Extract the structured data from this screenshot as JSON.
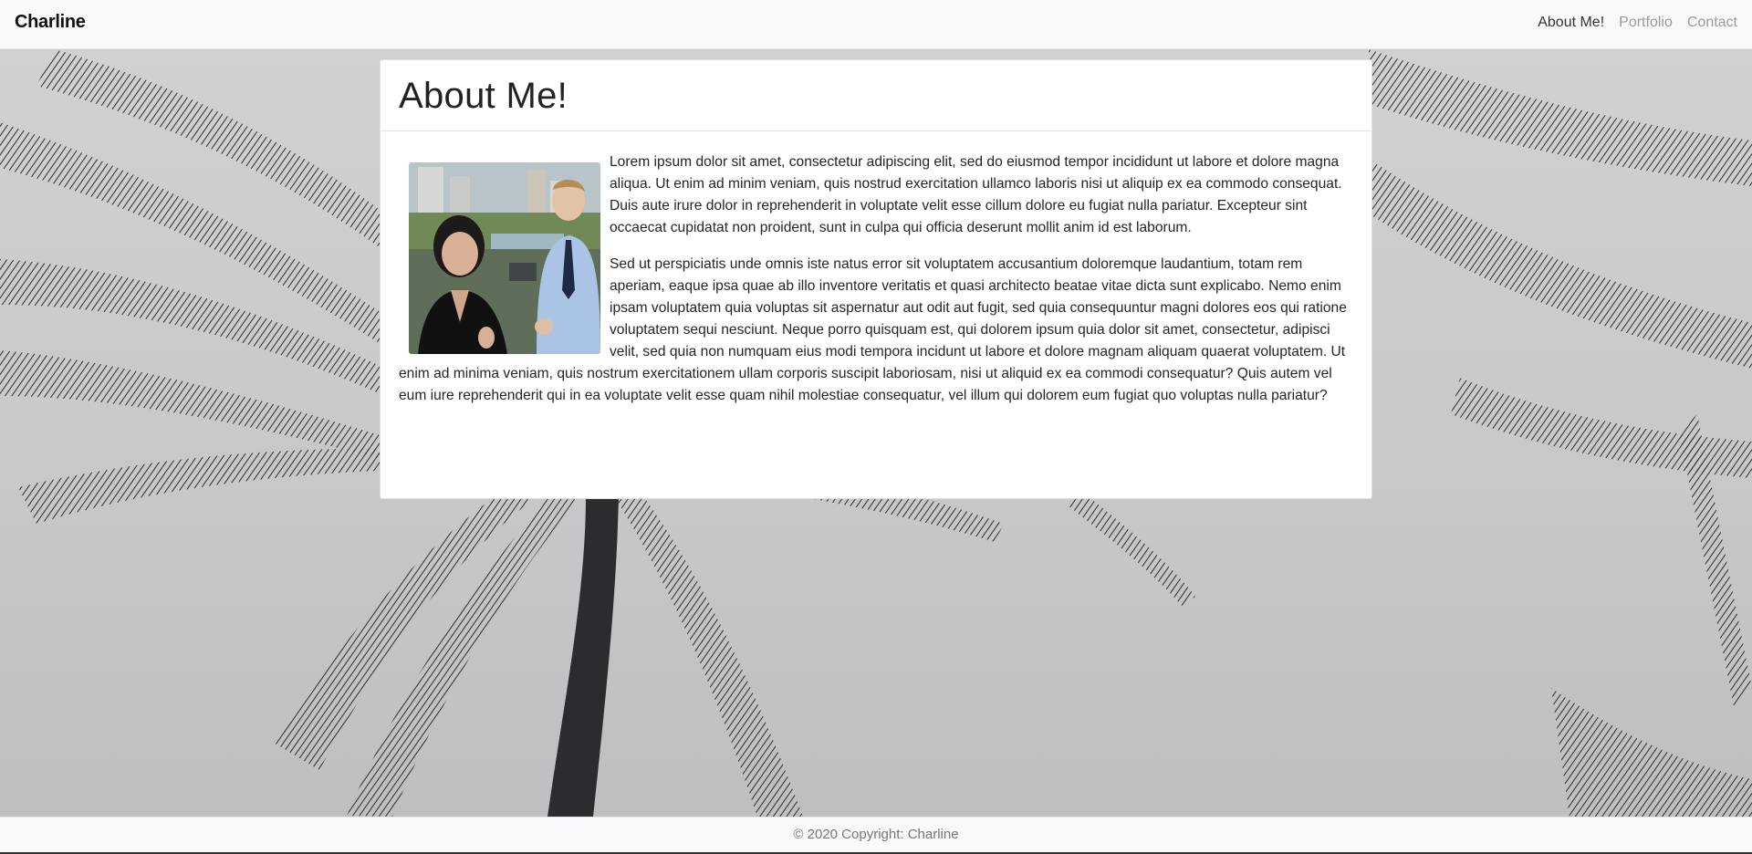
{
  "nav": {
    "brand": "Charline",
    "links": [
      {
        "label": "About Me!",
        "active": true
      },
      {
        "label": "Portfolio",
        "active": false
      },
      {
        "label": "Contact",
        "active": false
      }
    ]
  },
  "about": {
    "title": "About Me!",
    "paragraph1": "Lorem ipsum dolor sit amet, consectetur adipiscing elit, sed do eiusmod tempor incididunt ut labore et dolore magna aliqua. Ut enim ad minim veniam, quis nostrud exercitation ullamco laboris nisi ut aliquip ex ea commodo consequat. Duis aute irure dolor in reprehenderit in voluptate velit esse cillum dolore eu fugiat nulla pariatur. Excepteur sint occaecat cupidatat non proident, sunt in culpa qui officia deserunt mollit anim id est laborum.",
    "paragraph2": "Sed ut perspiciatis unde omnis iste natus error sit voluptatem accusantium doloremque laudantium, totam rem aperiam, eaque ipsa quae ab illo inventore veritatis et quasi architecto beatae vitae dicta sunt explicabo. Nemo enim ipsam voluptatem quia voluptas sit aspernatur aut odit aut fugit, sed quia consequuntur magni dolores eos qui ratione voluptatem sequi nesciunt. Neque porro quisquam est, qui dolorem ipsum quia dolor sit amet, consectetur, adipisci velit, sed quia non numquam eius modi tempora incidunt ut labore et dolore magnam aliquam quaerat voluptatem. Ut enim ad minima veniam, quis nostrum exercitationem ullam corporis suscipit laboriosam, nisi ut aliquid ex ea commodi consequatur? Quis autem vel eum iure reprehenderit qui in ea voluptate velit esse quam nihil molestiae consequatur, vel illum qui dolorem eum fugiat quo voluptas nulla pariatur?"
  },
  "footer": {
    "text": "© 2020 Copyright: Charline"
  },
  "colors": {
    "navbar_bg": "#f8f9fa",
    "nav_active": "#333333",
    "nav_inactive": "#9a9a9a",
    "sky": "#c9cbcd",
    "palm": "#2b2d30"
  }
}
